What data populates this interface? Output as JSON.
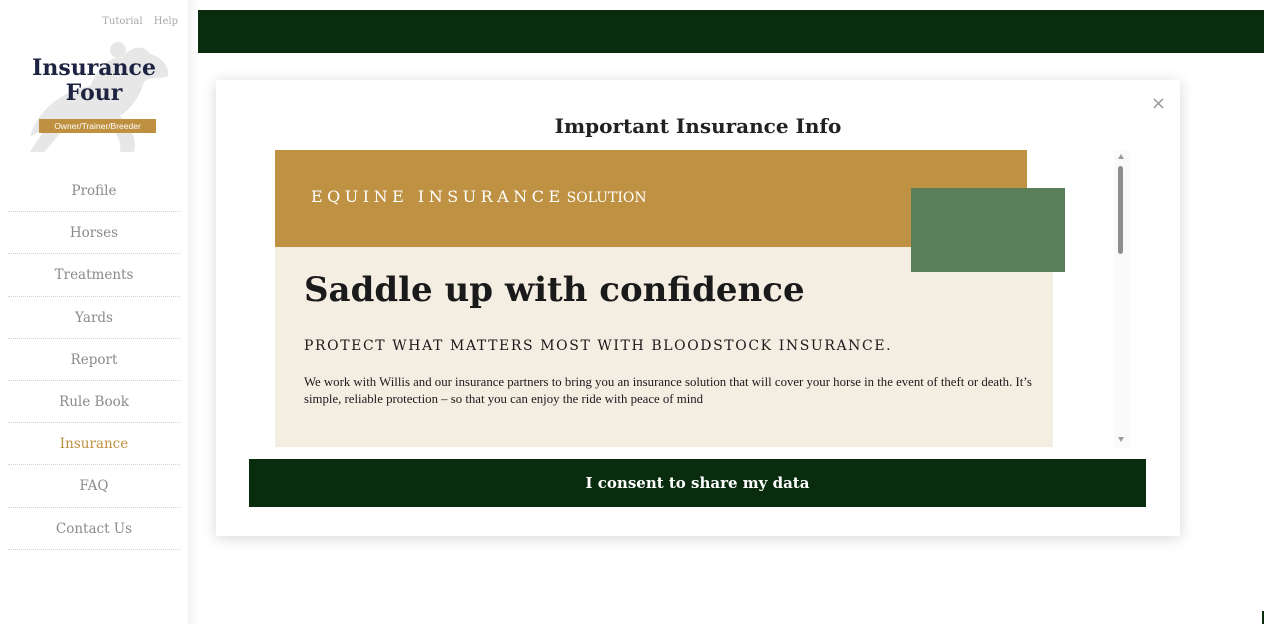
{
  "header": {
    "top_links": [
      "Tutorial",
      "Help"
    ]
  },
  "brand": {
    "title_line1": "Insurance",
    "title_line2": "Four",
    "badge": "Owner/Trainer/Breeder"
  },
  "sidebar": {
    "active_index": 6,
    "items": [
      {
        "label": "Profile"
      },
      {
        "label": "Horses"
      },
      {
        "label": "Treatments"
      },
      {
        "label": "Yards"
      },
      {
        "label": "Report"
      },
      {
        "label": "Rule Book"
      },
      {
        "label": "Insurance"
      },
      {
        "label": "FAQ"
      },
      {
        "label": "Contact Us"
      }
    ]
  },
  "modal": {
    "title": "Important Insurance Info",
    "close_symbol": "×",
    "banner_main": "EQUINE INSURANCE",
    "banner_small": "SOLUTION",
    "headline": "Saddle up with confidence",
    "subhead": "PROTECT WHAT MATTERS MOST WITH BLOODSTOCK INSURANCE.",
    "body": "We work with Willis and our insurance partners to bring you an insurance solution that will cover your horse in the event of theft or death. It’s simple, reliable protection – so that you can enjoy the ride with peace of mind",
    "consent_button": "I consent to share my data"
  },
  "colors": {
    "dark_green": "#0a2c0e",
    "gold": "#bf9142",
    "sage": "#5a7f58",
    "cream": "#f4ede2",
    "active_nav": "#bf9040"
  }
}
